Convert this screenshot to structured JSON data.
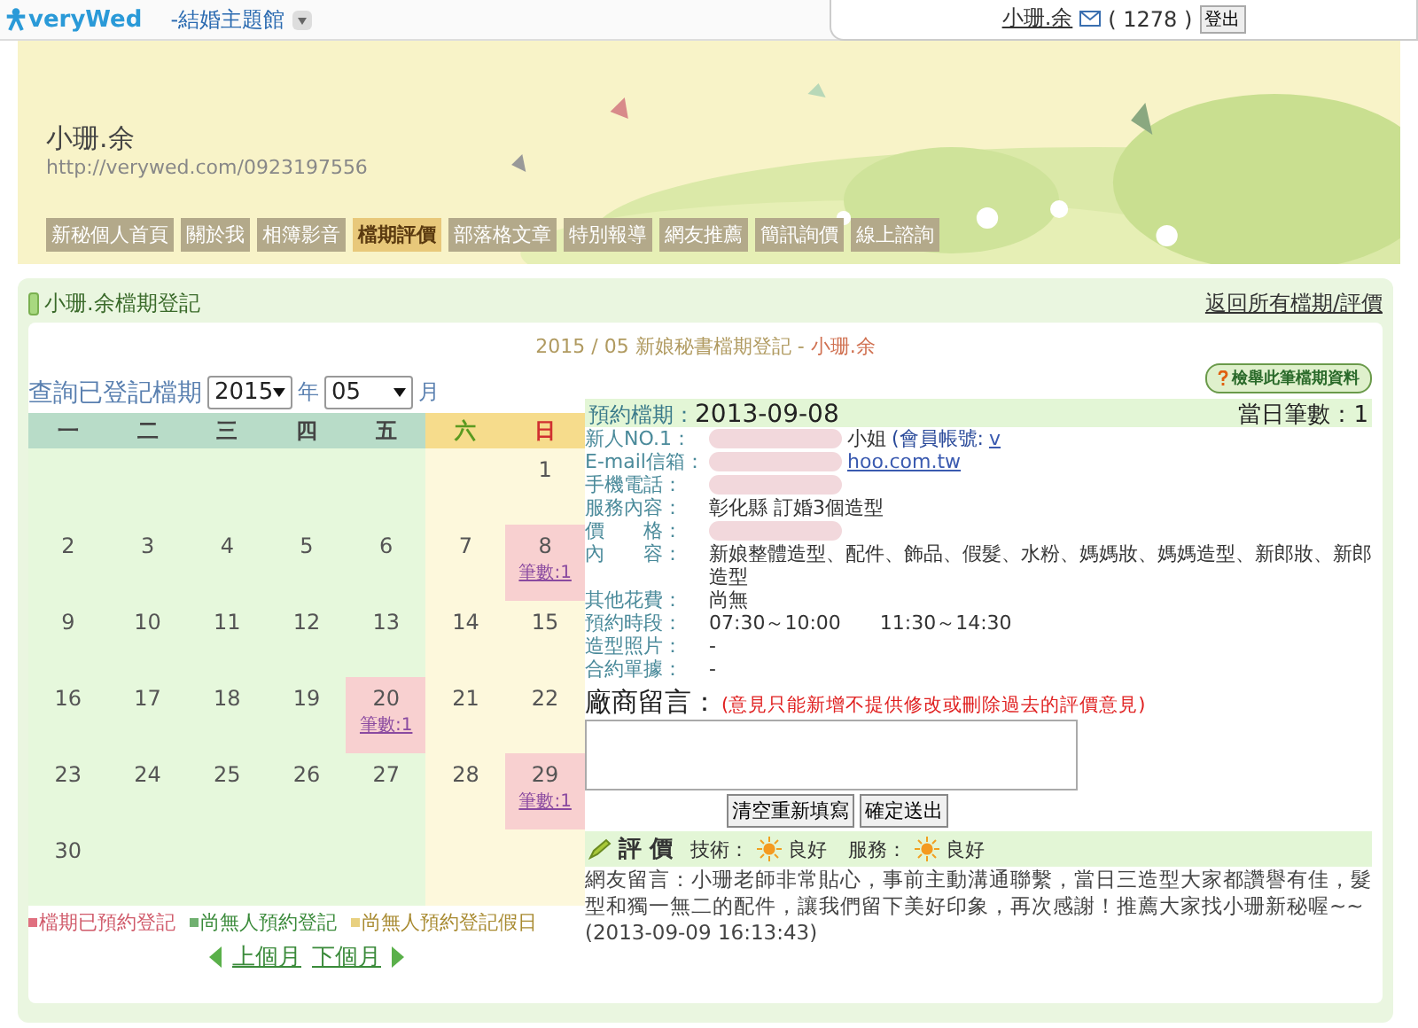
{
  "top_bar": {
    "logo": "veryWed",
    "site_menu": "-結婚主題館",
    "user": "小珊.余",
    "message_count": "( 1278 )",
    "logout": "登出"
  },
  "banner": {
    "name": "小珊.余",
    "url": "http://verywed.com/0923197556",
    "tabs": [
      {
        "label": "新秘個人首頁",
        "selected": false
      },
      {
        "label": "關於我",
        "selected": false
      },
      {
        "label": "相簿影音",
        "selected": false
      },
      {
        "label": "檔期評價",
        "selected": true
      },
      {
        "label": "部落格文章",
        "selected": false
      },
      {
        "label": "特別報導",
        "selected": false
      },
      {
        "label": "網友推薦",
        "selected": false
      },
      {
        "label": "簡訊詢價",
        "selected": false
      },
      {
        "label": "線上諮詢",
        "selected": false
      }
    ]
  },
  "panel": {
    "title": "小珊.余檔期登記",
    "back_link": "返回所有檔期/評價",
    "calendar_title": "2015 / 05 新娘秘書檔期登記 - ",
    "calendar_owner": "小珊.余",
    "query": {
      "label": "查詢已登記檔期",
      "year": "2015",
      "year_unit": "年",
      "month": "05",
      "month_unit": "月"
    },
    "weekdays": [
      {
        "label": "一",
        "kind": "weekday"
      },
      {
        "label": "二",
        "kind": "weekday"
      },
      {
        "label": "三",
        "kind": "weekday"
      },
      {
        "label": "四",
        "kind": "weekday"
      },
      {
        "label": "五",
        "kind": "weekday"
      },
      {
        "label": "六",
        "kind": "saturday"
      },
      {
        "label": "日",
        "kind": "sunday"
      }
    ],
    "weeks": [
      [
        {
          "kind": "empty"
        },
        {
          "kind": "empty"
        },
        {
          "kind": "empty"
        },
        {
          "kind": "empty"
        },
        {
          "kind": "empty"
        },
        {
          "kind": "empty"
        },
        {
          "day": "1",
          "booked": false
        }
      ],
      [
        {
          "day": "2",
          "booked": false
        },
        {
          "day": "3",
          "booked": false
        },
        {
          "day": "4",
          "booked": false
        },
        {
          "day": "5",
          "booked": false
        },
        {
          "day": "6",
          "booked": false
        },
        {
          "day": "7",
          "booked": false
        },
        {
          "day": "8",
          "booked": true,
          "count": "筆數:1"
        }
      ],
      [
        {
          "day": "9",
          "booked": false
        },
        {
          "day": "10",
          "booked": false
        },
        {
          "day": "11",
          "booked": false
        },
        {
          "day": "12",
          "booked": false
        },
        {
          "day": "13",
          "booked": false
        },
        {
          "day": "14",
          "booked": false
        },
        {
          "day": "15",
          "booked": false
        }
      ],
      [
        {
          "day": "16",
          "booked": false
        },
        {
          "day": "17",
          "booked": false
        },
        {
          "day": "18",
          "booked": false
        },
        {
          "day": "19",
          "booked": false
        },
        {
          "day": "20",
          "booked": true,
          "count": "筆數:1"
        },
        {
          "day": "21",
          "booked": false
        },
        {
          "day": "22",
          "booked": false
        }
      ],
      [
        {
          "day": "23",
          "booked": false
        },
        {
          "day": "24",
          "booked": false
        },
        {
          "day": "25",
          "booked": false
        },
        {
          "day": "26",
          "booked": false
        },
        {
          "day": "27",
          "booked": false
        },
        {
          "day": "28",
          "booked": false
        },
        {
          "day": "29",
          "booked": true,
          "count": "筆數:1"
        }
      ],
      [
        {
          "day": "30",
          "booked": false
        },
        {
          "kind": "empty"
        },
        {
          "kind": "empty"
        },
        {
          "kind": "empty"
        },
        {
          "kind": "empty"
        },
        {
          "kind": "empty"
        },
        {
          "kind": "empty"
        }
      ]
    ],
    "legend": [
      {
        "label": "檔期已預約登記",
        "color": "#e07080"
      },
      {
        "label": "尚無人預約登記",
        "color": "#70b070"
      },
      {
        "label": "尚無人預約登記假日",
        "color": "#e8d080"
      }
    ],
    "prev_month": "上個月",
    "next_month": "下個月",
    "report_button": "檢舉此筆檔期資料",
    "booking": {
      "date_label": "預約檔期：",
      "date": "2013-09-08",
      "count_label": "當日筆數：",
      "count": "1",
      "fields": [
        {
          "label": "新人NO.1：",
          "value": "小姐",
          "member_label": "(會員帳號:",
          "member_id": "v",
          "redacted": true
        },
        {
          "label": "E-mail信箱：",
          "link": "hoo.com.tw",
          "redacted": true
        },
        {
          "label": "手機電話：",
          "redacted": true
        },
        {
          "label": "服務內容：",
          "value": "彰化縣 訂婚3個造型"
        },
        {
          "label": "價　　格：",
          "redacted": true
        },
        {
          "label": "內　　容：",
          "value": "新娘整體造型、配件、飾品、假髮、水粉、媽媽妝、媽媽造型、新郎妝、新郎造型"
        },
        {
          "label": "其他花費：",
          "value": "尚無"
        },
        {
          "label": "預約時段：",
          "value": "07:30～10:00　　11:30～14:30"
        },
        {
          "label": "造型照片：",
          "value": "-"
        },
        {
          "label": "合約單據：",
          "value": "-"
        }
      ]
    },
    "vendor_message": {
      "label": "廠商留言：",
      "note": "(意見只能新增不提供修改或刪除過去的評價意見)",
      "clear_button": "清空重新填寫",
      "submit_button": "確定送出"
    },
    "rating": {
      "title": "評 價",
      "tech_label": "技術：",
      "tech_value": "良好",
      "service_label": "服務：",
      "service_value": "良好",
      "comment": "網友留言：小珊老師非常貼心，事前主動溝通聯繫，當日三造型大家都讚譽有佳，髮型和獨一無二的配件，讓我們留下美好印象，再次感謝！推薦大家找小珊新秘喔~~　(2013-09-09 16:13:43)"
    }
  }
}
